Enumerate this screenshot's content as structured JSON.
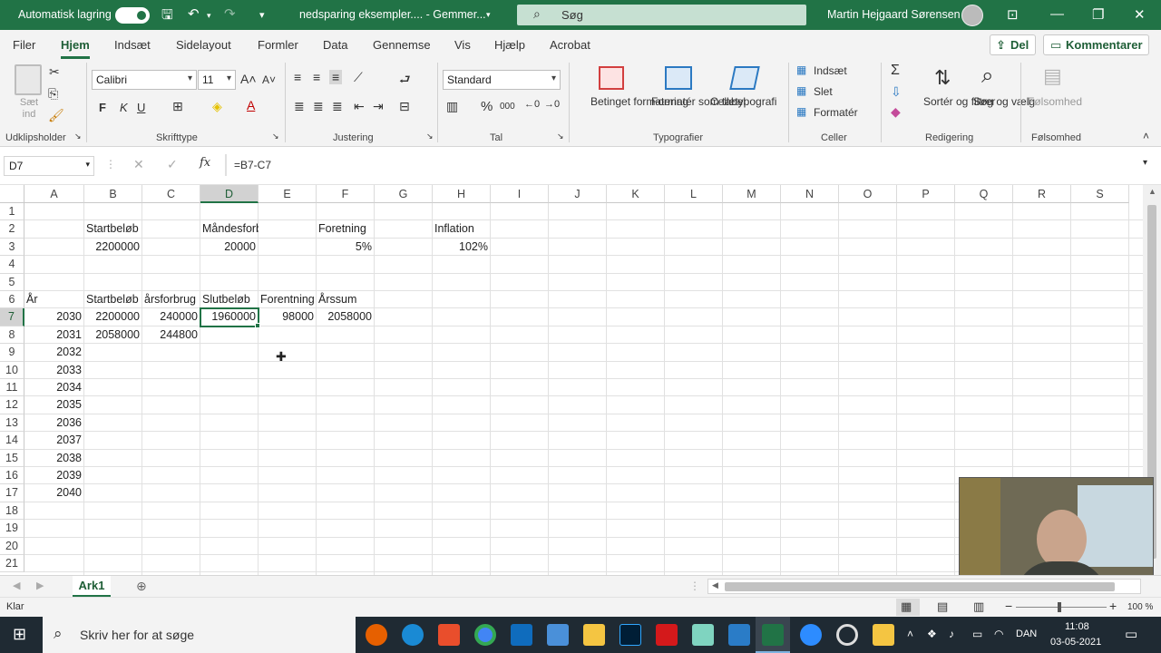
{
  "titlebar": {
    "autosave_label": "Automatisk lagring",
    "filename": "nedsparing eksempler....  -  Gemmer...",
    "search_placeholder": "Søg",
    "user": "Martin Hejgaard Sørensen"
  },
  "tabs": [
    "Filer",
    "Hjem",
    "Indsæt",
    "Sidelayout",
    "Formler",
    "Data",
    "Gennemse",
    "Vis",
    "Hjælp",
    "Acrobat"
  ],
  "share_label": "Del",
  "comment_label": "Kommentarer",
  "ribbon": {
    "paste_label": "Sæt ind",
    "clipboard_group": "Udklipsholder",
    "font_name": "Calibri",
    "font_size": "11",
    "font_group": "Skrifttype",
    "bold": "F",
    "italic": "K",
    "underline": "U",
    "alignment_group": "Justering",
    "number_format": "Standard",
    "number_group": "Tal",
    "percent": "%",
    "thousands": "000",
    "cond_format": "Betinget formatering",
    "format_table": "Formatér som tabel",
    "cell_styles": "Celletypografi",
    "styles_group": "Typografier",
    "insert": "Indsæt",
    "delete": "Slet",
    "format": "Formatér",
    "cells_group": "Celler",
    "sort_filter": "Sortér og filtrer",
    "find_select": "Søg og vælg",
    "editing_group": "Redigering",
    "sensitivity": "Følsomhed",
    "sensitivity_group": "Følsomhed"
  },
  "formula_bar": {
    "name_box": "D7",
    "formula": "=B7-C7"
  },
  "columns": [
    "A",
    "B",
    "C",
    "D",
    "E",
    "F",
    "G",
    "H",
    "I",
    "J",
    "K",
    "L",
    "M",
    "N",
    "O",
    "P",
    "Q",
    "R",
    "S"
  ],
  "rows": [
    "1",
    "2",
    "3",
    "4",
    "5",
    "6",
    "7",
    "8",
    "9",
    "10",
    "11",
    "12",
    "13",
    "14",
    "15",
    "16",
    "17",
    "18",
    "19",
    "20",
    "21"
  ],
  "cells": {
    "B2": "Startbeløb",
    "D2": "Måndesforbrug",
    "F2": "Foretning",
    "H2": "Inflation",
    "B3": "2200000",
    "D3": "20000",
    "F3": "5%",
    "H3": "102%",
    "A6": "År",
    "B6": "Startbeløb",
    "C6": "årsforbrug",
    "D6": "Slutbeløb",
    "E6": "Forentning",
    "F6": "Årssum",
    "A7": "2030",
    "B7": "2200000",
    "C7": "240000",
    "D7": "1960000",
    "E7": "98000",
    "F7": "2058000",
    "A8": "2031",
    "B8": "2058000",
    "C8": "244800",
    "A9": "2032",
    "A10": "2033",
    "A11": "2034",
    "A12": "2035",
    "A13": "2036",
    "A14": "2037",
    "A15": "2038",
    "A16": "2039",
    "A17": "2040"
  },
  "sheet_tab": "Ark1",
  "status": {
    "ready": "Klar",
    "zoom": "100 %"
  },
  "taskbar": {
    "search_placeholder": "Skriv her for at søge",
    "language": "DAN",
    "time": "11:08",
    "date": "03-05-2021"
  },
  "colors": {
    "excel_green": "#217346",
    "selection": "#217346"
  }
}
